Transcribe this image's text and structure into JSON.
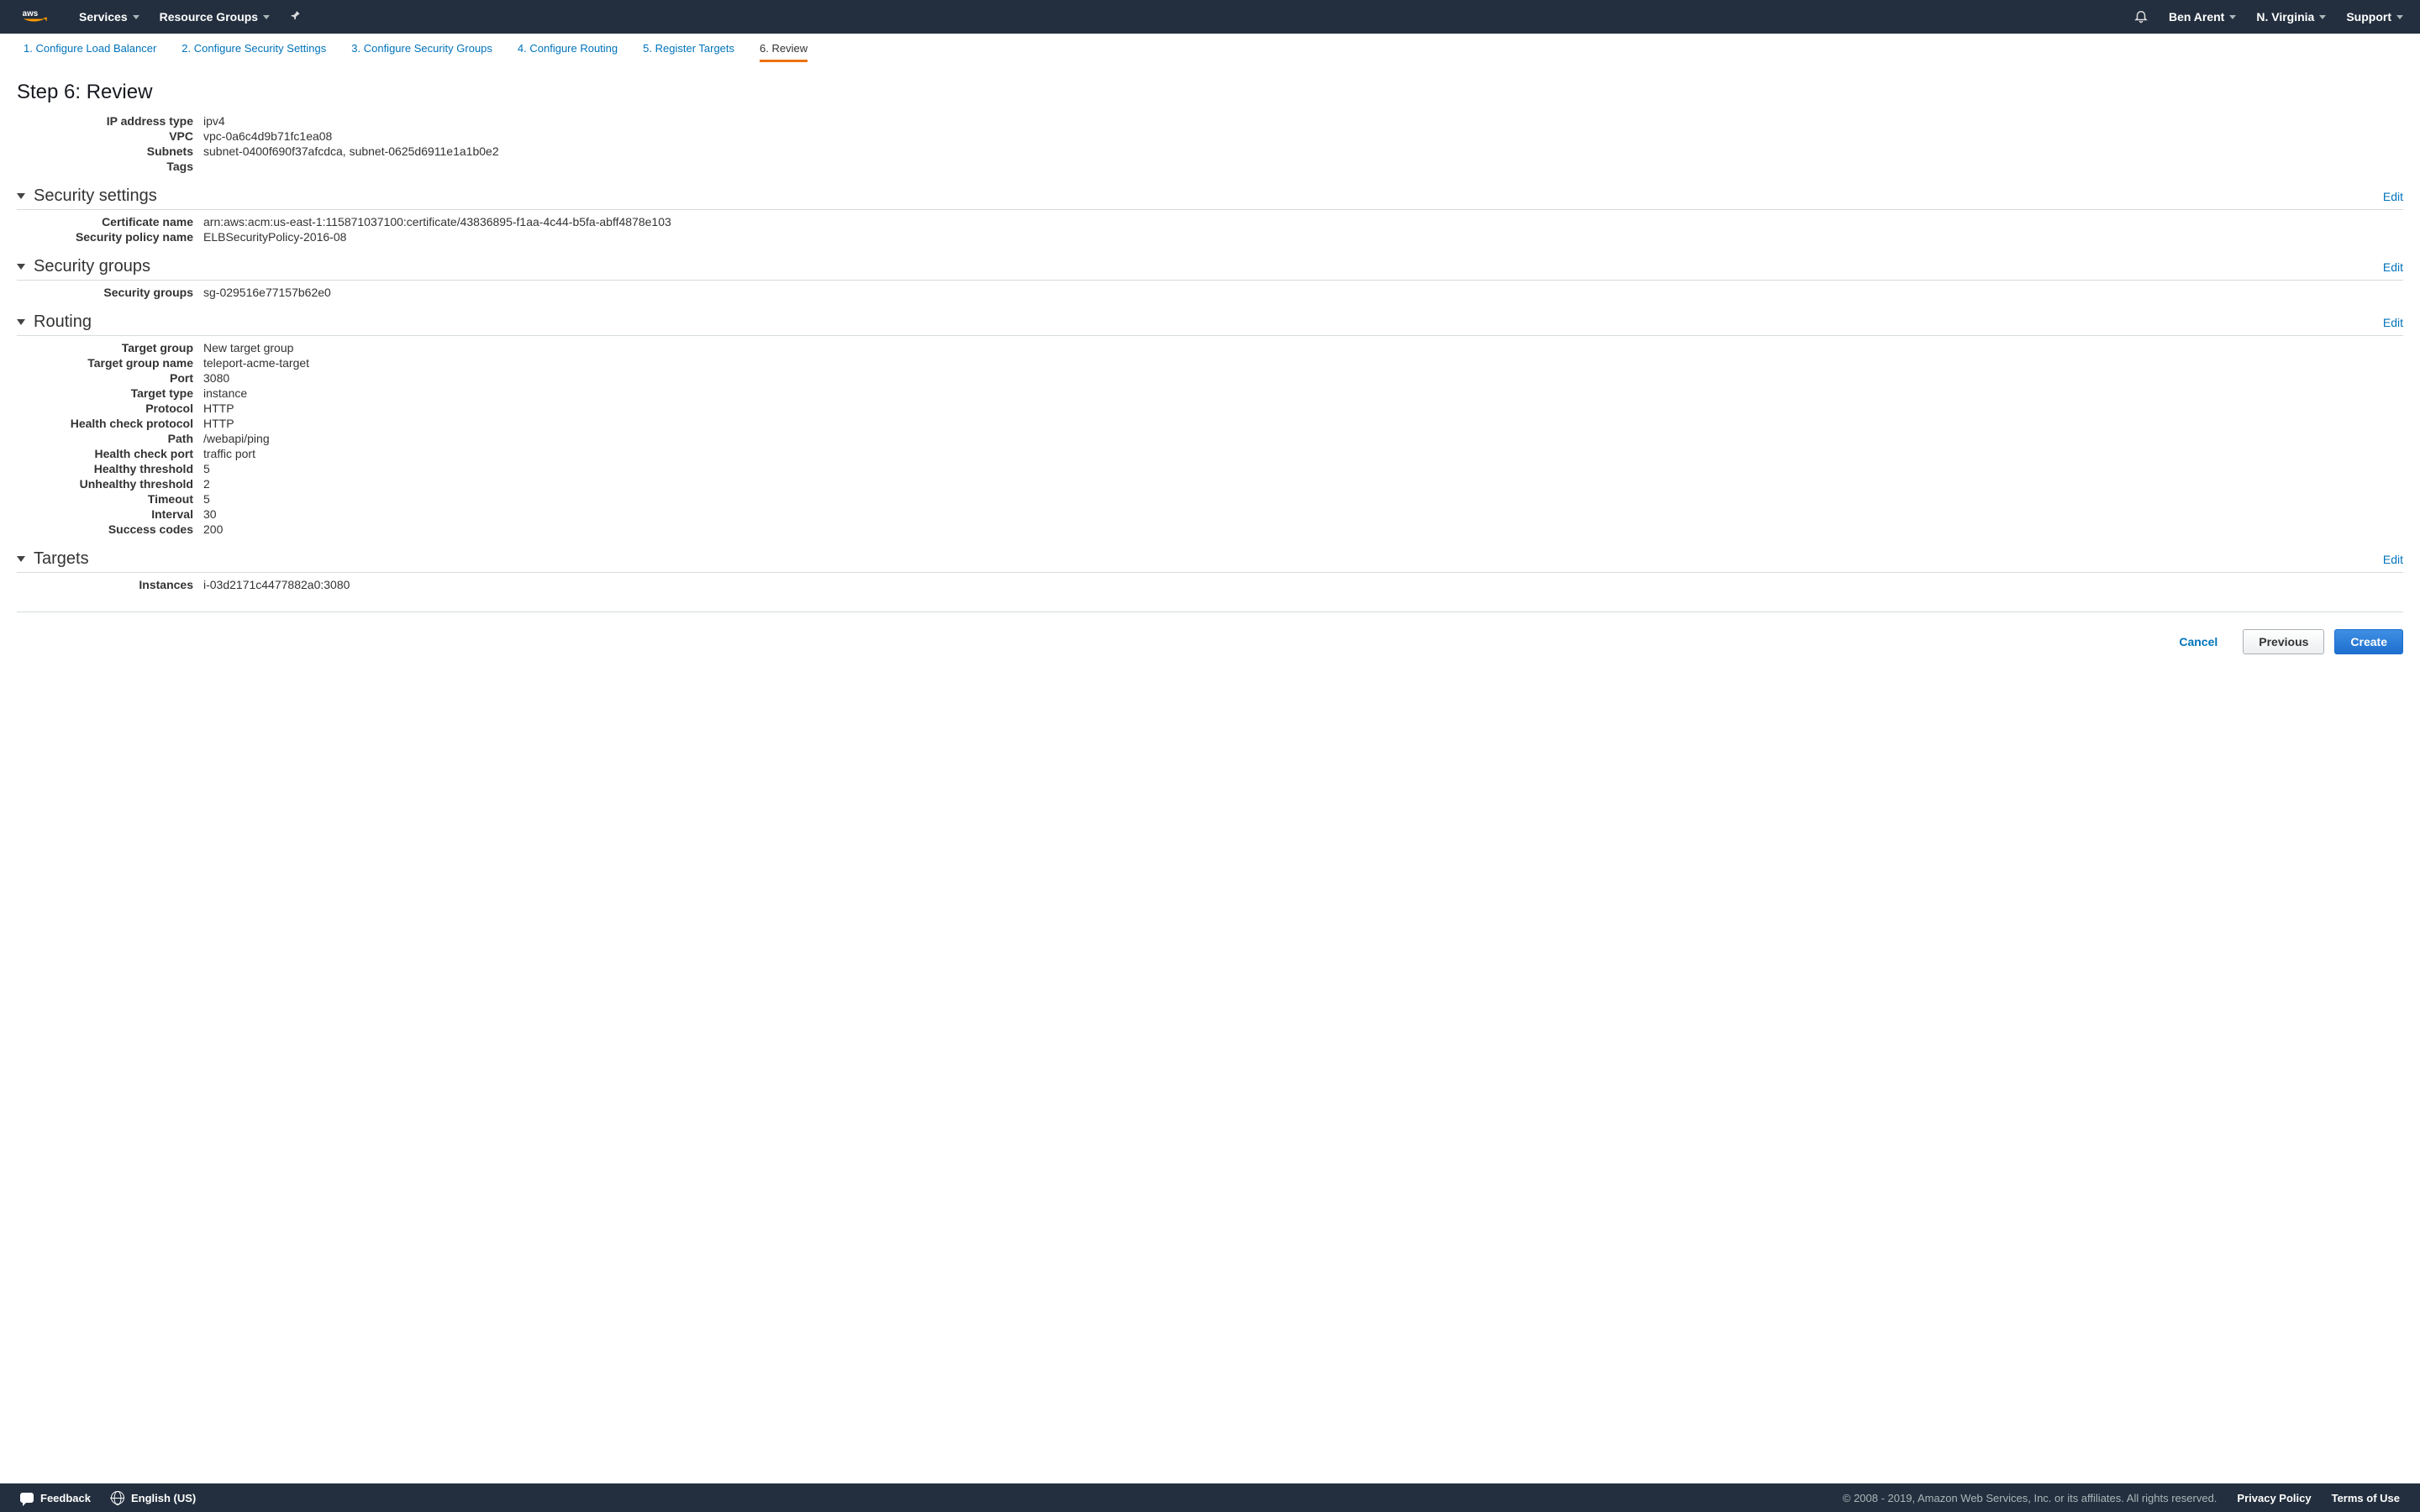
{
  "nav": {
    "services": "Services",
    "resourceGroups": "Resource Groups",
    "user": "Ben Arent",
    "region": "N. Virginia",
    "support": "Support"
  },
  "steps": [
    "1. Configure Load Balancer",
    "2. Configure Security Settings",
    "3. Configure Security Groups",
    "4. Configure Routing",
    "5. Register Targets",
    "6. Review"
  ],
  "pageTitle": "Step 6: Review",
  "editLabel": "Edit",
  "basic": {
    "ipAddressType": {
      "label": "IP address type",
      "value": "ipv4"
    },
    "vpc": {
      "label": "VPC",
      "value": "vpc-0a6c4d9b71fc1ea08"
    },
    "subnets": {
      "label": "Subnets",
      "value": "subnet-0400f690f37afcdca, subnet-0625d6911e1a1b0e2"
    },
    "tags": {
      "label": "Tags",
      "value": ""
    }
  },
  "securitySettings": {
    "title": "Security settings",
    "certificateName": {
      "label": "Certificate name",
      "value": "arn:aws:acm:us-east-1:115871037100:certificate/43836895-f1aa-4c44-b5fa-abff4878e103"
    },
    "securityPolicyName": {
      "label": "Security policy name",
      "value": "ELBSecurityPolicy-2016-08"
    }
  },
  "securityGroups": {
    "title": "Security groups",
    "securityGroups": {
      "label": "Security groups",
      "value": "sg-029516e77157b62e0"
    }
  },
  "routing": {
    "title": "Routing",
    "targetGroup": {
      "label": "Target group",
      "value": "New target group"
    },
    "targetGroupName": {
      "label": "Target group name",
      "value": "teleport-acme-target"
    },
    "port": {
      "label": "Port",
      "value": "3080"
    },
    "targetType": {
      "label": "Target type",
      "value": "instance"
    },
    "protocol": {
      "label": "Protocol",
      "value": "HTTP"
    },
    "healthCheckProtocol": {
      "label": "Health check protocol",
      "value": "HTTP"
    },
    "path": {
      "label": "Path",
      "value": "/webapi/ping"
    },
    "healthCheckPort": {
      "label": "Health check port",
      "value": "traffic port"
    },
    "healthyThreshold": {
      "label": "Healthy threshold",
      "value": "5"
    },
    "unhealthyThreshold": {
      "label": "Unhealthy threshold",
      "value": "2"
    },
    "timeout": {
      "label": "Timeout",
      "value": "5"
    },
    "interval": {
      "label": "Interval",
      "value": "30"
    },
    "successCodes": {
      "label": "Success codes",
      "value": "200"
    }
  },
  "targets": {
    "title": "Targets",
    "instances": {
      "label": "Instances",
      "value": "i-03d2171c4477882a0:3080"
    }
  },
  "actions": {
    "cancel": "Cancel",
    "previous": "Previous",
    "create": "Create"
  },
  "footer": {
    "feedback": "Feedback",
    "language": "English (US)",
    "copyright": "© 2008 - 2019, Amazon Web Services, Inc. or its affiliates. All rights reserved.",
    "privacy": "Privacy Policy",
    "terms": "Terms of Use"
  }
}
